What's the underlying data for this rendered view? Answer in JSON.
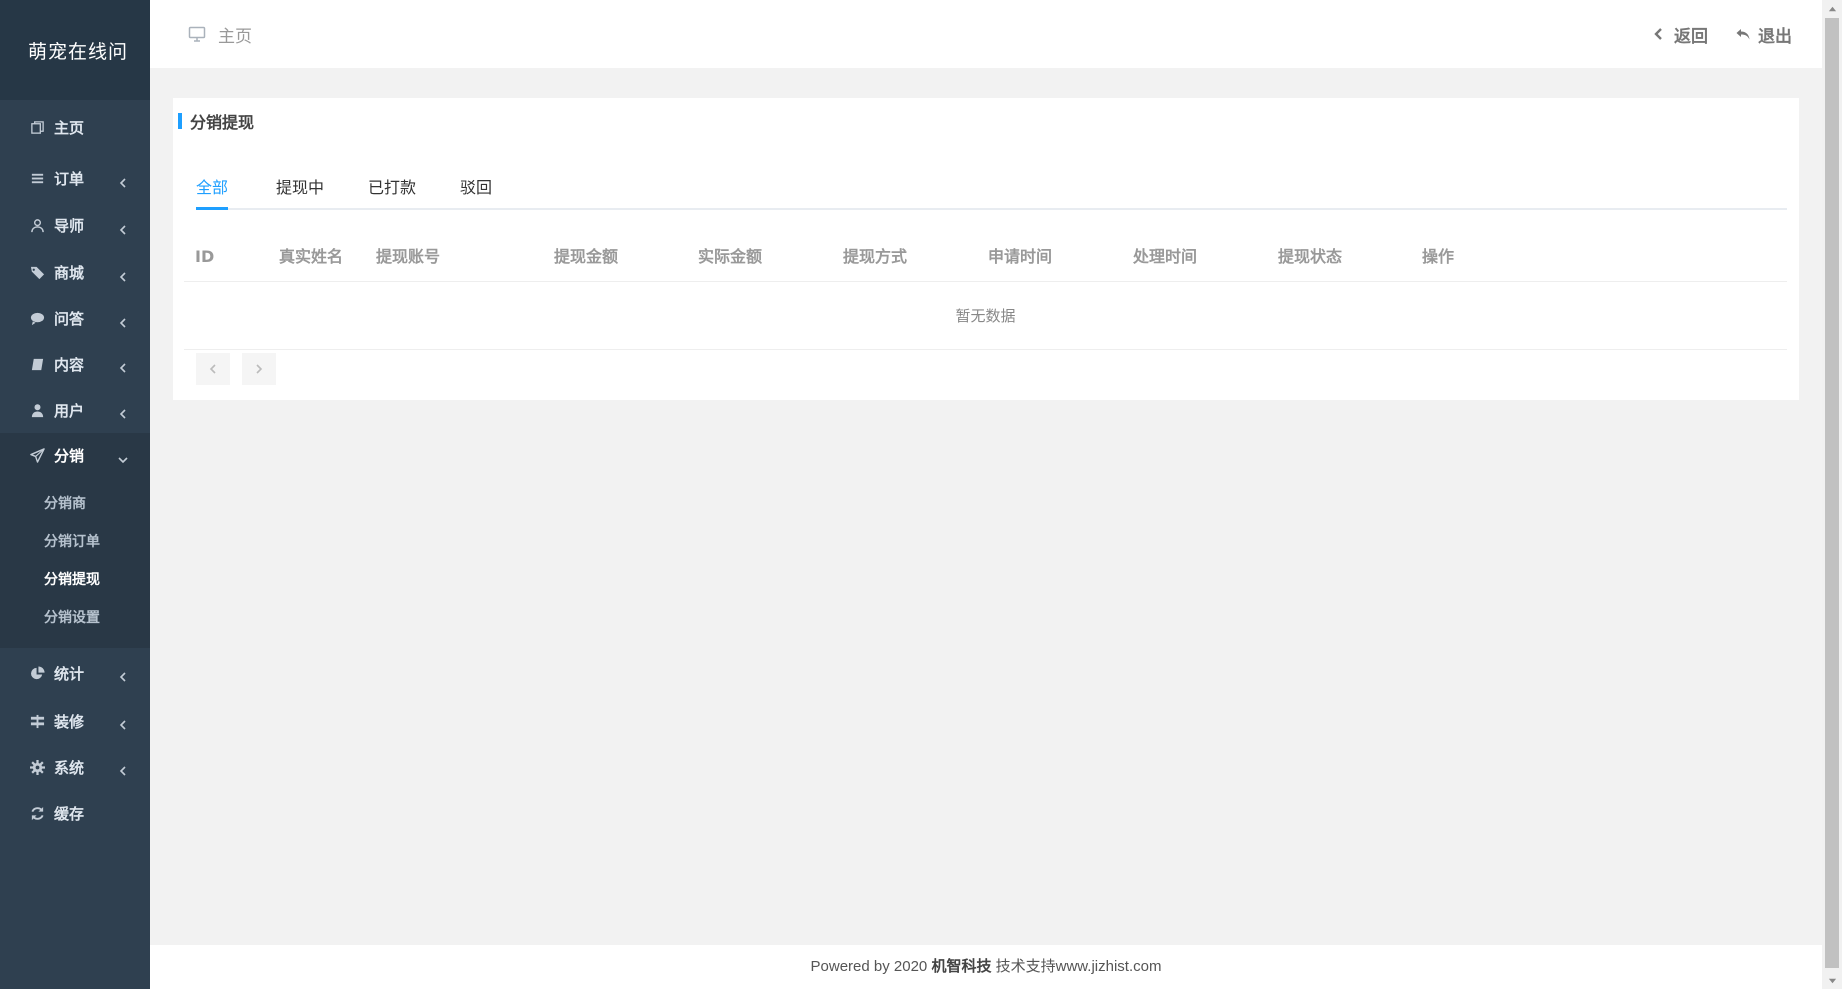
{
  "brand": "萌宠在线问",
  "sidebar": {
    "items": [
      {
        "label": "主页",
        "icon": "copy-icon",
        "arrow": false
      },
      {
        "label": "订单",
        "icon": "list-icon",
        "arrow": true
      },
      {
        "label": "导师",
        "icon": "user-outline-icon",
        "arrow": true
      },
      {
        "label": "商城",
        "icon": "tags-icon",
        "arrow": true
      },
      {
        "label": "问答",
        "icon": "comment-icon",
        "arrow": true
      },
      {
        "label": "内容",
        "icon": "book-icon",
        "arrow": true
      },
      {
        "label": "用户",
        "icon": "user-icon",
        "arrow": true
      },
      {
        "label": "分销",
        "icon": "paper-plane-icon",
        "arrow": true,
        "open": true
      },
      {
        "label": "统计",
        "icon": "pie-chart-icon",
        "arrow": true
      },
      {
        "label": "装修",
        "icon": "signpost-icon",
        "arrow": true
      },
      {
        "label": "系统",
        "icon": "gear-icon",
        "arrow": true
      },
      {
        "label": "缓存",
        "icon": "refresh-icon",
        "arrow": false
      }
    ],
    "sub_items": [
      {
        "label": "分销商"
      },
      {
        "label": "分销订单"
      },
      {
        "label": "分销提现",
        "active": true
      },
      {
        "label": "分销设置"
      }
    ]
  },
  "topbar": {
    "breadcrumb": "主页",
    "back_label": "返回",
    "logout_label": "退出"
  },
  "card": {
    "title": "分销提现",
    "tabs": [
      {
        "label": "全部",
        "active": true
      },
      {
        "label": "提现中"
      },
      {
        "label": "已打款"
      },
      {
        "label": "驳回"
      }
    ],
    "columns": [
      "ID",
      "真实姓名",
      "提现账号",
      "提现金额",
      "实际金额",
      "提现方式",
      "申请时间",
      "处理时间",
      "提现状态",
      "操作"
    ],
    "empty_text": "暂无数据"
  },
  "footer": {
    "prefix": "Powered by 2020 ",
    "company": "机智科技",
    "suffix": " 技术支持www.jizhist.com"
  },
  "colors": {
    "sidebar_bg": "#2f4050",
    "accent": "#1e9fff",
    "page_bg": "#f2f2f2"
  }
}
